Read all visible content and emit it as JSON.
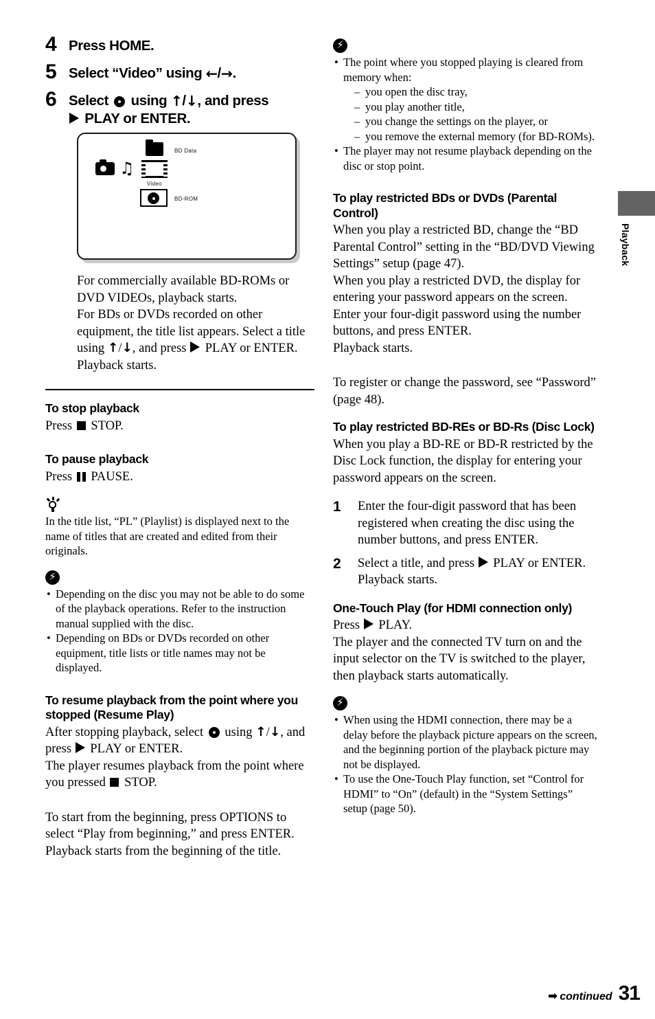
{
  "page": {
    "number": "31",
    "continued_label": "continued",
    "continued_arrow": "➡",
    "side_tab_label": "Playback",
    "side_tab_color": "#636363"
  },
  "left_column": {
    "steps": [
      {
        "num": "4",
        "text": "Press HOME."
      },
      {
        "num": "5",
        "text_pre": "Select “Video” using ",
        "arrow_left": "←",
        "slash": "/",
        "arrow_right": "→",
        "text_post": "."
      },
      {
        "num": "6",
        "text_pre": "Select ",
        "icon": "disc-icon",
        "text_mid": " using ",
        "arrow_up": "↑",
        "slash": "/",
        "arrow_down": "↓",
        "text_post": ", and press",
        "line2_pre": " PLAY or ENTER.",
        "play_icon": "play-icon"
      }
    ],
    "screen_illustration": {
      "icons": [
        "photo-camera-icon",
        "music-note-icon",
        "film-strip-icon",
        "folder-icon",
        "disc-box-icon"
      ],
      "labels": {
        "bd_data": "BD Data",
        "video": "Video",
        "bd_rom": "BD-ROM"
      }
    },
    "intro_paragraph": [
      "For commercially available BD-ROMs",
      "or DVD VIDEOs, playback starts.",
      "For BDs or DVDs recorded on other",
      "equipment, the title list appears. Select a",
      "title using ↑/↓, and press ▶ PLAY or",
      "ENTER.",
      "Playback starts."
    ],
    "intro_p1": "For commercially available BD-ROMs or DVD VIDEOs, playback starts.",
    "intro_p2_a": "For BDs or DVDs recorded on other equipment, the title list appears. Select a title using ",
    "intro_p2_b": ", and press ",
    "intro_p2_c": " PLAY or ENTER.",
    "intro_p3": "Playback starts.",
    "stop_section": {
      "heading": "To stop playback",
      "text_pre": "Press ",
      "text_post": " STOP."
    },
    "pause_section": {
      "heading": "To pause playback",
      "text_pre": "Press ",
      "text_post": " PAUSE."
    },
    "tip": {
      "icon": "tip-bulb-icon",
      "text": "In the title list, “PL” (Playlist) is displayed next to the name of titles that are created and edited from their originals."
    },
    "note": {
      "icon": "note-bolt-icon",
      "bullets": [
        "Depending on the disc you may not be able to do some of the playback operations. Refer to the instruction manual supplied with the disc.",
        "Depending on BDs or DVDs recorded on other equipment, title lists or title names may not be displayed."
      ]
    },
    "resume_section": {
      "heading": "To resume playback from the point where you stopped (Resume Play)",
      "line1_a": "After stopping playback, select ",
      "line1_b": " using ",
      "line2_a": ", and press ",
      "line2_b": " PLAY or ENTER.",
      "line3_a": "The player resumes playback from the point where you pressed ",
      "line3_b": " STOP."
    },
    "begin_paragraph": "To start from the beginning, press OPTIONS to select “Play from beginning,” and press ENTER. Playback starts from the beginning of the title."
  },
  "right_column": {
    "note_top": {
      "icon": "note-bolt-icon",
      "bullet1_intro": "The point where you stopped playing is cleared from memory when:",
      "dashes": [
        "you open the disc tray,",
        "you play another title,",
        "you change the settings on the player, or",
        "you remove the external memory (for BD-ROMs)."
      ],
      "bullet2": "The player may not resume playback depending on the disc or stop point."
    },
    "parental_section": {
      "heading": "To play restricted BDs or DVDs (Parental Control)",
      "paragraph1": "When you play a restricted BD, change the “BD Parental Control” setting in the “BD/DVD Viewing Settings” setup (page 47).",
      "paragraph2": "When you play a restricted DVD, the display for entering your password appears on the screen.",
      "paragraph3": "Enter your four-digit password using the number buttons, and press ENTER.",
      "paragraph4": "Playback starts."
    },
    "register_paragraph": "To register or change the password, see “Password” (page 48).",
    "disclock_section": {
      "heading": "To play restricted BD-REs or BD-Rs (Disc Lock)",
      "paragraph": "When you play a BD-RE or BD-R restricted by the Disc Lock function, the display for entering your password appears on the screen.",
      "steps": [
        {
          "num": "1",
          "text": "Enter the four-digit password that has been registered when creating the disc using the number buttons, and press ENTER."
        },
        {
          "num": "2",
          "text_a": "Select a title, and press ",
          "text_b": " PLAY or ENTER.",
          "text_c": "Playback starts."
        }
      ]
    },
    "onetouch_section": {
      "heading": "One-Touch Play (for HDMI connection only)",
      "press_pre": "Press ",
      "press_post": " PLAY.",
      "paragraph": "The player and the connected TV turn on and the input selector on the TV is switched to the player, then playback starts automatically."
    },
    "note_bottom": {
      "icon": "note-bolt-icon",
      "bullets": [
        "When using the HDMI connection, there may be a delay before the playback picture appears on the screen, and the beginning portion of the playback picture may not be displayed.",
        "To use the One-Touch Play function, set “Control for HDMI” to “On” (default) in the “System Settings” setup (page 50)."
      ]
    }
  }
}
